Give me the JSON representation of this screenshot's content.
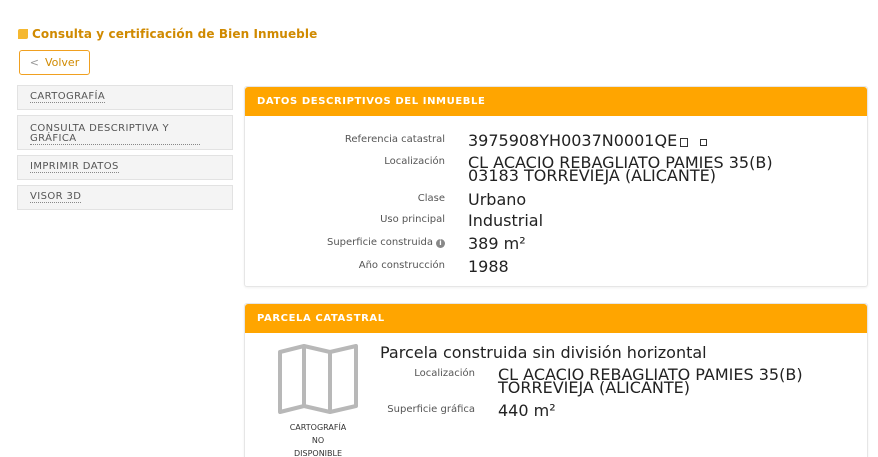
{
  "page": {
    "title": "Consulta y certificación de Bien Inmueble",
    "back_label": "Volver"
  },
  "sidebar": {
    "items": [
      {
        "label": "CARTOGRAFÍA"
      },
      {
        "label": "CONSULTA DESCRIPTIVA Y GRÁFICA"
      },
      {
        "label": "IMPRIMIR DATOS"
      },
      {
        "label": "VISOR 3D"
      }
    ]
  },
  "inmueble": {
    "header": "DATOS DESCRIPTIVOS DEL INMUEBLE",
    "ref_label": "Referencia catastral",
    "ref_value": "3975908YH0037N0001QE",
    "loc_label": "Localización",
    "loc_line1": "CL ACACIO REBAGLIATO PAMIES 35(B)",
    "loc_line2": "03183 TORREVIEJA (ALICANTE)",
    "clase_label": "Clase",
    "clase_value": "Urbano",
    "uso_label": "Uso principal",
    "uso_value": "Industrial",
    "sup_label": "Superficie construida",
    "sup_value": "389 m²",
    "anio_label": "Año construcción",
    "anio_value": "1988"
  },
  "parcela": {
    "header": "PARCELA CATASTRAL",
    "desc": "Parcela construida sin división horizontal",
    "loc_label": "Localización",
    "loc_line1": "CL ACACIO REBAGLIATO PAMIES 35(B)",
    "loc_line2": "TORREVIEJA (ALICANTE)",
    "sup_label": "Superficie gráfica",
    "sup_value": "440 m²",
    "map_caption_1": "CARTOGRAFÍA",
    "map_caption_2": "NO",
    "map_caption_3": "DISPONIBLE"
  },
  "icons": {
    "title_bullet": "square-bullet-icon",
    "back": "chevron-left-icon",
    "copy": "copy-icon",
    "qr": "qr-code-icon",
    "info": "info-icon",
    "map": "map-unavailable-icon"
  },
  "colors": {
    "accent": "#ffa500",
    "title": "#d08a00"
  }
}
